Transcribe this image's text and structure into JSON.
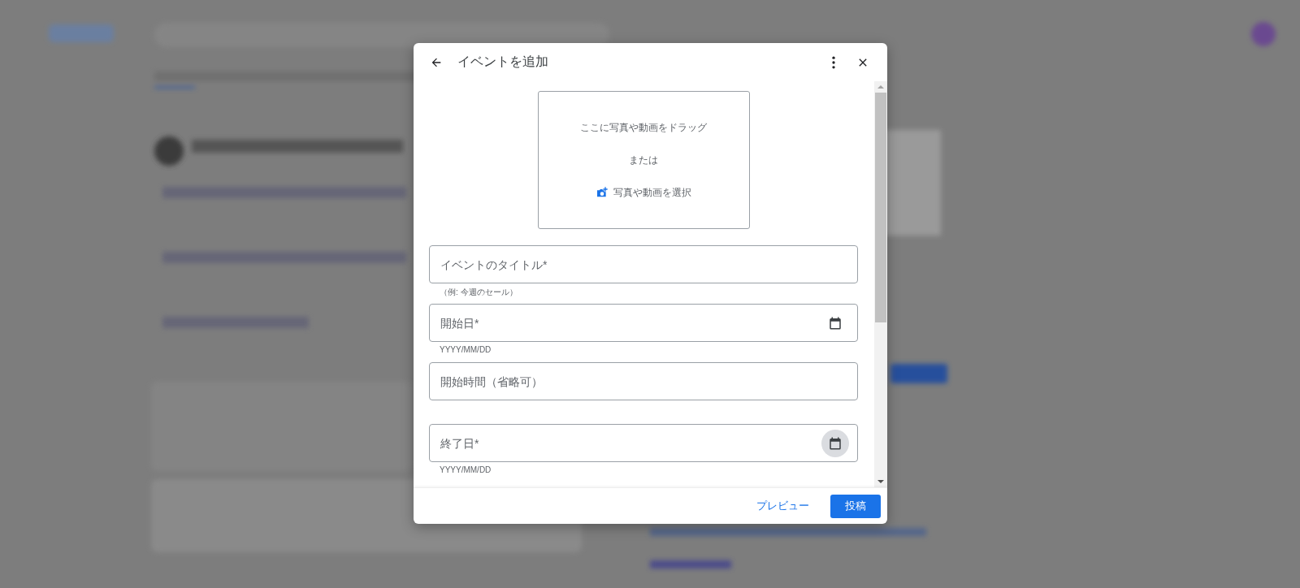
{
  "dialog": {
    "title": "イベントを追加",
    "upload": {
      "prompt": "ここに写真や動画をドラッグ",
      "separator": "または",
      "link": "写真や動画を選択"
    },
    "fields": [
      {
        "kind": "text",
        "placeholder": "イベントのタイトル*",
        "helper": "（例: 今週のセール）"
      },
      {
        "kind": "date",
        "placeholder": "開始日*",
        "helper": "YYYY/MM/DD",
        "hovered": false
      },
      {
        "kind": "text",
        "placeholder": "開始時間（省略可）"
      },
      {
        "kind": "date",
        "placeholder": "終了日*",
        "helper": "YYYY/MM/DD",
        "hovered": true
      }
    ],
    "buttons": [
      {
        "kind": "text",
        "label": "プレビュー"
      },
      {
        "kind": "filled",
        "label": "投稿"
      }
    ]
  }
}
